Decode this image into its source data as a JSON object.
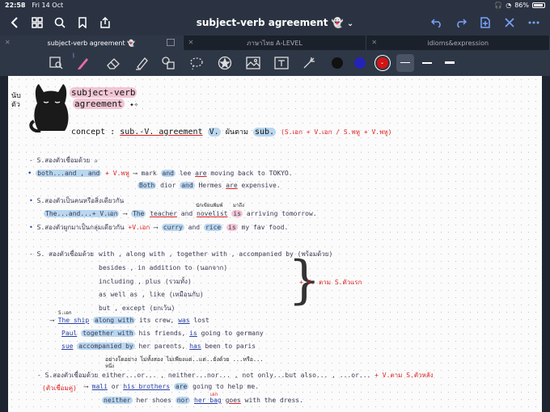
{
  "status": {
    "time": "22:58",
    "date": "Fri 14 Oct",
    "battery": "86%"
  },
  "nav": {
    "title": "subject-verb agreement 👻",
    "chevron": "⌄"
  },
  "tabs": [
    {
      "label": "subject-verb agreement 👻",
      "active": true
    },
    {
      "label": "ภาษาไทย A-LEVEL",
      "active": false
    },
    {
      "label": "idioms&expression",
      "active": false
    }
  ],
  "toolbar": {
    "colors": [
      "#111111",
      "#2323b8",
      "#d41414"
    ],
    "selected_color": "#d41414"
  },
  "note": {
    "title_line1": "subject-verb",
    "title_line2": "agreement",
    "sparkle": "✦✧",
    "cat_label": "นับ\nตัว",
    "concept_label": "concept :",
    "concept_main": "sub.-V. agreement",
    "concept_v": "V.",
    "concept_thai": "ผันตาม",
    "concept_sub": "sub.",
    "concept_rule": "(S.เอก + V.เอก / S.พหู + V.พหู)",
    "s1_heading": "- S.สองตัวเชื่อมด้วย",
    "s1_star": "✰",
    "s1_a_tag": "both...and , and",
    "s1_a_rule": "+ V.พหู",
    "s1_a_arrow": "⟶",
    "s1_a_ex1_p1": "mark",
    "s1_a_ex1_and": "and",
    "s1_a_ex1_p2": "lee",
    "s1_a_ex1_are": "are",
    "s1_a_ex1_rest": "moving  back to TOKYO.",
    "s1_a_ex2_both": "Both",
    "s1_a_ex2_p1": "dior",
    "s1_a_ex2_and": "and",
    "s1_a_ex2_p2": "Hermes",
    "s1_a_ex2_are": "are",
    "s1_a_ex2_rest": "expensive.",
    "s1_b_heading": "S.สองตัวเป็นคนหรือสิ่งเดียวกัน",
    "s1_b_tag": "The...and...+ V.เอก",
    "s1_b_arrow": "⟶",
    "s1_b_ex_the": "The",
    "s1_b_ex_teacher": "teacher",
    "s1_b_ex_and": "and",
    "s1_b_ex_novelist": "novelist",
    "s1_b_ex_is": "is",
    "s1_b_ex_rest": "arriving  tomorrow.",
    "s1_b_note1": "นักเขียนพิมพ์",
    "s1_b_note2": "มาถึง",
    "s1_c_heading": "S.สองตัวผูกมาเป็นกลุ่มเดียวกัน",
    "s1_c_rule": "+V.เอก",
    "s1_c_arrow": "⟶",
    "s1_c_ex_curry": "curry",
    "s1_c_ex_and": "and",
    "s1_c_ex_rice": "rice",
    "s1_c_ex_is": "is",
    "s1_c_ex_rest": "my  fav  food.",
    "s2_heading": "- S. สองตัวเชื่อมด้วย",
    "s2_line1": "with , along with , together with , accompanied by (พร้อมด้วย)",
    "s2_line2": "besides , in addition to (นอกจาก)",
    "s2_line3": "including , plus (รวมทั้ง)",
    "s2_line4": "as well as , like (เหมือนกับ)",
    "s2_line5": "but , except (ยกเว้น)",
    "s2_rule": "+ V. ตาม S.ตัวแรก",
    "s2_brace": "}",
    "s2_ex_label": "S.เอก",
    "s2_ex1_the": "The ship",
    "s2_ex1_along": "along with",
    "s2_ex1_rest": "its crew,",
    "s2_ex1_was": "was",
    "s2_ex1_end": "lost",
    "s2_ex2_paul": "Paul",
    "s2_ex2_tog": "together with",
    "s2_ex2_rest": "his friends,",
    "s2_ex2_is": "is",
    "s2_ex2_end": "going to germany",
    "s2_ex3_sue": "sue",
    "s2_ex3_acc": "accompanied by",
    "s2_ex3_rest": "her parents,",
    "s2_ex3_has": "has",
    "s2_ex3_end": "been to paris",
    "s3_notes": "อย่างใดอย่าง    ไม่ทั้งสอง    ไม่เพียงแต่..แต่..ยังด้วย     ...หรือ...",
    "s3_notes_sub": "หนึ่ง",
    "s3_heading": "- S.สองตัวเชื่อมด้วย",
    "s3_conj": "either...or... , neither...nor... , not only...but also... , ...or...",
    "s3_rule": "+ V.ตาม S.ตัวหลัง",
    "s3_paren": "(ตัวเชื่อมคู่)",
    "s3_ex1_mali": "mali",
    "s3_ex1_or": "or",
    "s3_ex1_his": "his brothers",
    "s3_ex1_are": "are",
    "s3_ex1_rest": "going to help me.",
    "s3_ex2_neither": "neither",
    "s3_ex2_shoes": "her shoes",
    "s3_ex2_nor": "nor",
    "s3_ex2_bag": "her bag",
    "s3_ex2_goes": "goes",
    "s3_ex2_rest": "with the dress.",
    "s3_ex2_note": "เอก"
  }
}
